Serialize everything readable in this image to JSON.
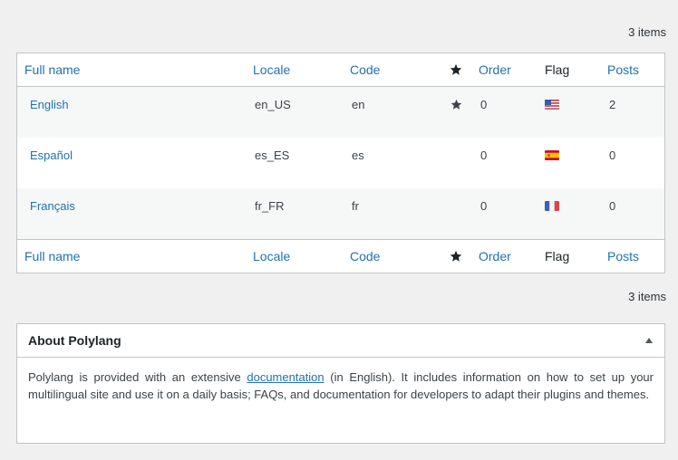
{
  "items_count_top": "3 items",
  "items_count_bottom": "3 items",
  "table": {
    "columns": {
      "full_name": "Full name",
      "locale": "Locale",
      "code": "Code",
      "order": "Order",
      "flag": "Flag",
      "posts": "Posts"
    },
    "rows": [
      {
        "name": "English",
        "locale": "en_US",
        "code": "en",
        "default": true,
        "order": "0",
        "flag": "us-flag-icon",
        "posts": "2"
      },
      {
        "name": "Español",
        "locale": "es_ES",
        "code": "es",
        "default": false,
        "order": "0",
        "flag": "es-flag-icon",
        "posts": "0"
      },
      {
        "name": "Français",
        "locale": "fr_FR",
        "code": "fr",
        "default": false,
        "order": "0",
        "flag": "fr-flag-icon",
        "posts": "0"
      }
    ]
  },
  "about": {
    "title": "About Polylang",
    "text_before": "Polylang is provided with an extensive ",
    "link": "documentation",
    "text_after": " (in English). It includes information on how to set up your multilingual site and use it on a daily basis; FAQs, and documentation for developers to adapt their plugins and themes."
  },
  "colors": {
    "link": "#2271b1",
    "background": "#f0f0f1",
    "border": "#c3c4c7",
    "alt_row": "#f6f7f7"
  }
}
